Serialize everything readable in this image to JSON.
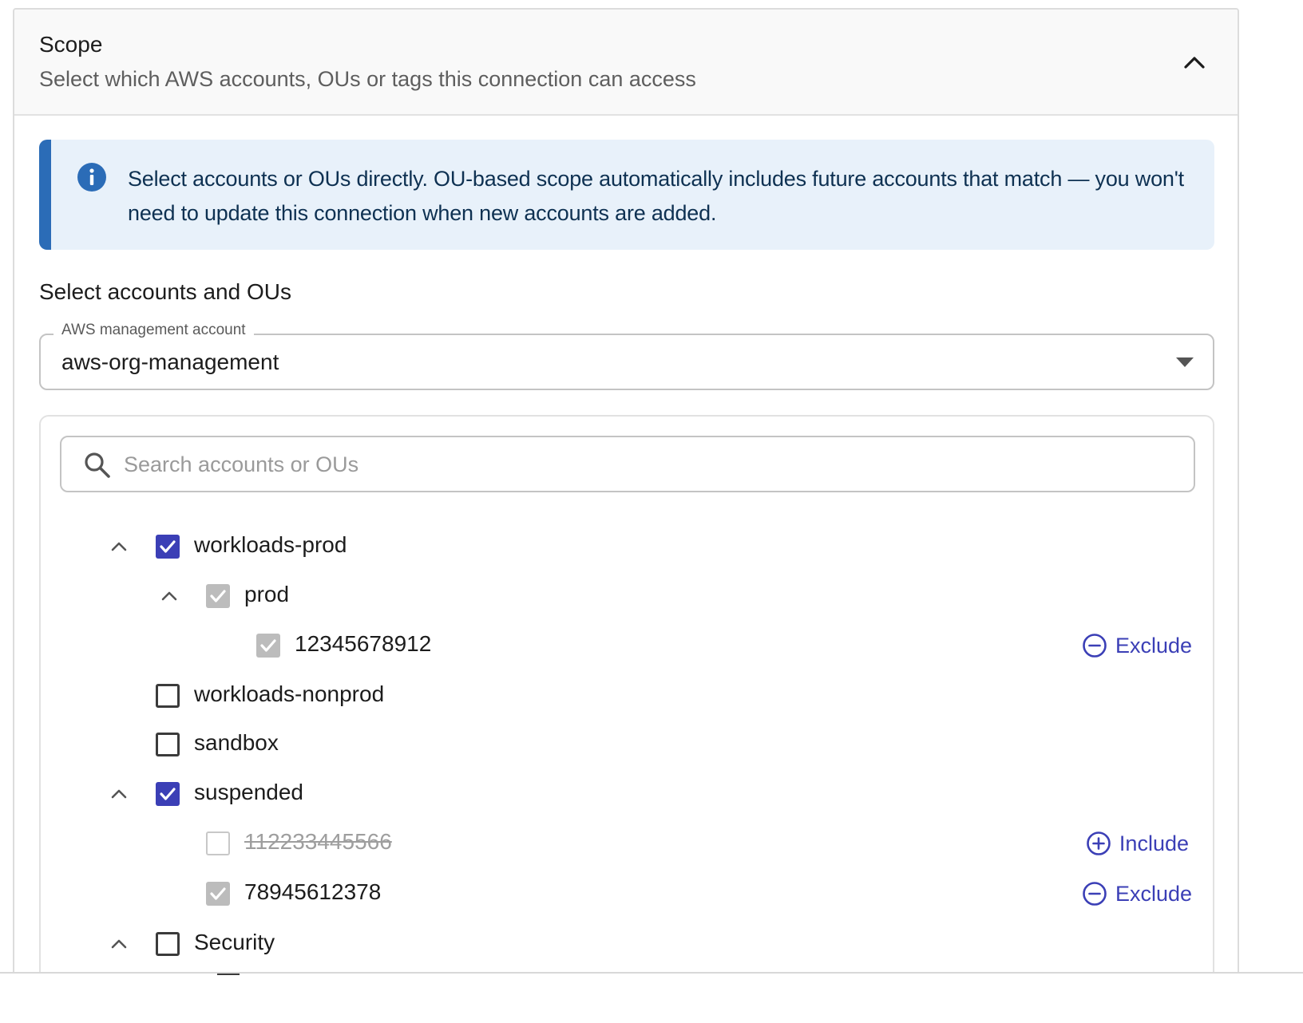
{
  "header": {
    "title": "Scope",
    "subtitle": "Select which AWS accounts, OUs or tags this connection can access",
    "collapse_icon": "chevron-up-icon"
  },
  "alert": {
    "icon": "info-icon",
    "color": "#2b6cb7",
    "text": "Select accounts or OUs directly. OU-based scope automatically includes future accounts that match — you won't need to update this connection when new accounts are added."
  },
  "section": {
    "title": "Select accounts and OUs"
  },
  "management_account": {
    "label": "AWS management account",
    "value": "aws-org-management"
  },
  "search": {
    "placeholder": "Search accounts or OUs"
  },
  "tree": {
    "accent": "#3b3fb6",
    "rows": [
      {
        "label": "workloads-prod",
        "state": "checked",
        "expanded": true
      },
      {
        "label": "prod",
        "state": "inherited",
        "expanded": true
      },
      {
        "label": "12345678912",
        "state": "inherited",
        "action": "Exclude"
      },
      {
        "label": "workloads-nonprod",
        "state": "unchecked"
      },
      {
        "label": "sandbox",
        "state": "unchecked"
      },
      {
        "label": "suspended",
        "state": "checked",
        "expanded": true
      },
      {
        "label": "112233445566",
        "state": "excluded",
        "action": "Include"
      },
      {
        "label": "78945612378",
        "state": "inherited",
        "action": "Exclude"
      },
      {
        "label": "Security",
        "state": "unchecked",
        "expanded": true
      }
    ]
  }
}
